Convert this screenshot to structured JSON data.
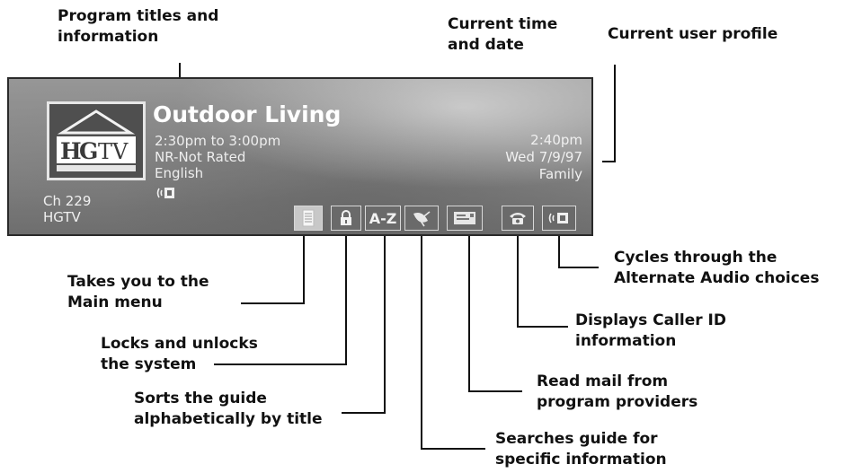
{
  "callouts": {
    "program_titles": [
      "Program titles and",
      "information"
    ],
    "current_time": [
      "Current time",
      "and date"
    ],
    "user_profile": "Current user profile",
    "main_menu": [
      "Takes you to the",
      "Main menu"
    ],
    "lock": [
      "Locks and unlocks",
      "the system"
    ],
    "sort": [
      "Sorts the guide",
      "alphabetically by title"
    ],
    "search": [
      "Searches guide for",
      "specific information"
    ],
    "mail": [
      "Read mail from",
      "program providers"
    ],
    "caller_id": [
      "Displays Caller ID",
      "information"
    ],
    "audio": [
      "Cycles through the",
      "Alternate Audio choices"
    ]
  },
  "banner": {
    "logo_text": "HGTV",
    "logo_subtext": "HOME & GARDEN TELEVISION",
    "channel": "Ch 229",
    "channel_name": "HGTV",
    "program_title": "Outdoor Living",
    "program_time": "2:30pm to 3:00pm",
    "rating": "NR-Not Rated",
    "language": "English",
    "current_time": "2:40pm",
    "current_date": "Wed 7/9/97",
    "profile": "Family",
    "buttons": {
      "az_label": "A-Z"
    }
  },
  "icons": {
    "main_menu": "list-icon",
    "lock": "lock-icon",
    "search": "satellite-dish-icon",
    "mail": "mail-icon",
    "caller_id": "telephone-icon",
    "audio": "speaker-icon"
  }
}
